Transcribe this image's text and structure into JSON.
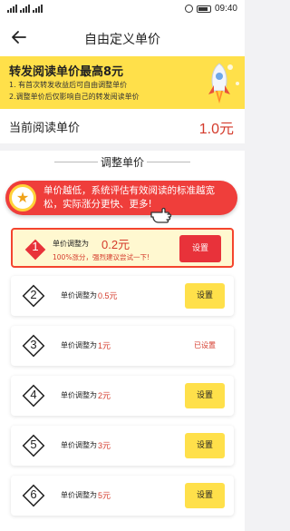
{
  "status_bar": {
    "time": "09:40"
  },
  "nav": {
    "title": "自由定义单价"
  },
  "banner": {
    "title": "转发阅读单价最高8元",
    "line1": "1. 有首次转发收益后可自由调整单价",
    "line2": "2.调整单价后仅影响自己的转发阅读单价"
  },
  "current": {
    "label": "当前阅读单价",
    "value": "1.0元"
  },
  "section": {
    "title": "调整单价"
  },
  "tip": {
    "text": "单价越低，系统评估有效阅读的标准越宽松，实际涨分更快、更多!"
  },
  "colors": {
    "accent_red": "#e8323a",
    "accent_yellow": "#ffe04a"
  },
  "options": [
    {
      "num": "1",
      "label": "单价调整为",
      "value": "0.2元",
      "hint": "100%涨分，强烈建议尝试一下!",
      "action": "设置"
    },
    {
      "num": "2",
      "label": "单价调整为",
      "value": "0.5元",
      "action": "设置"
    },
    {
      "num": "3",
      "label": "单价调整为",
      "value": "1元",
      "action": "已设置"
    },
    {
      "num": "4",
      "label": "单价调整为",
      "value": "2元",
      "action": "设置"
    },
    {
      "num": "5",
      "label": "单价调整为",
      "value": "3元",
      "action": "设置"
    },
    {
      "num": "6",
      "label": "单价调整为",
      "value": "5元",
      "action": "设置"
    }
  ]
}
